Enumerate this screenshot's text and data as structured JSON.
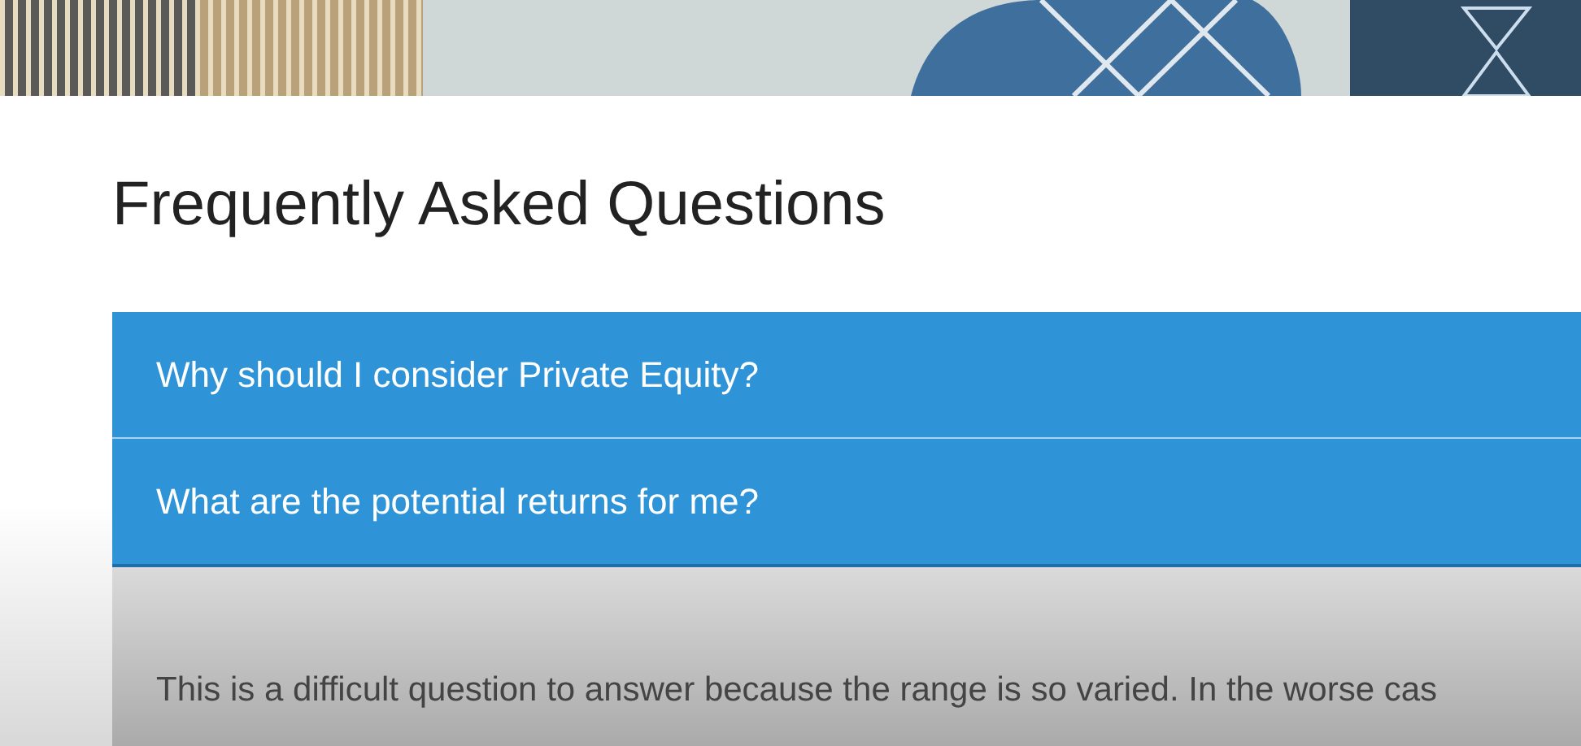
{
  "title": "Frequently Asked Questions",
  "faq": [
    {
      "question": "Why should I consider Private Equity?",
      "expanded": false
    },
    {
      "question": "What are the potential returns for me?",
      "expanded": true,
      "answer": "This is a difficult question to answer because the range is so varied. In the worse cas"
    }
  ]
}
